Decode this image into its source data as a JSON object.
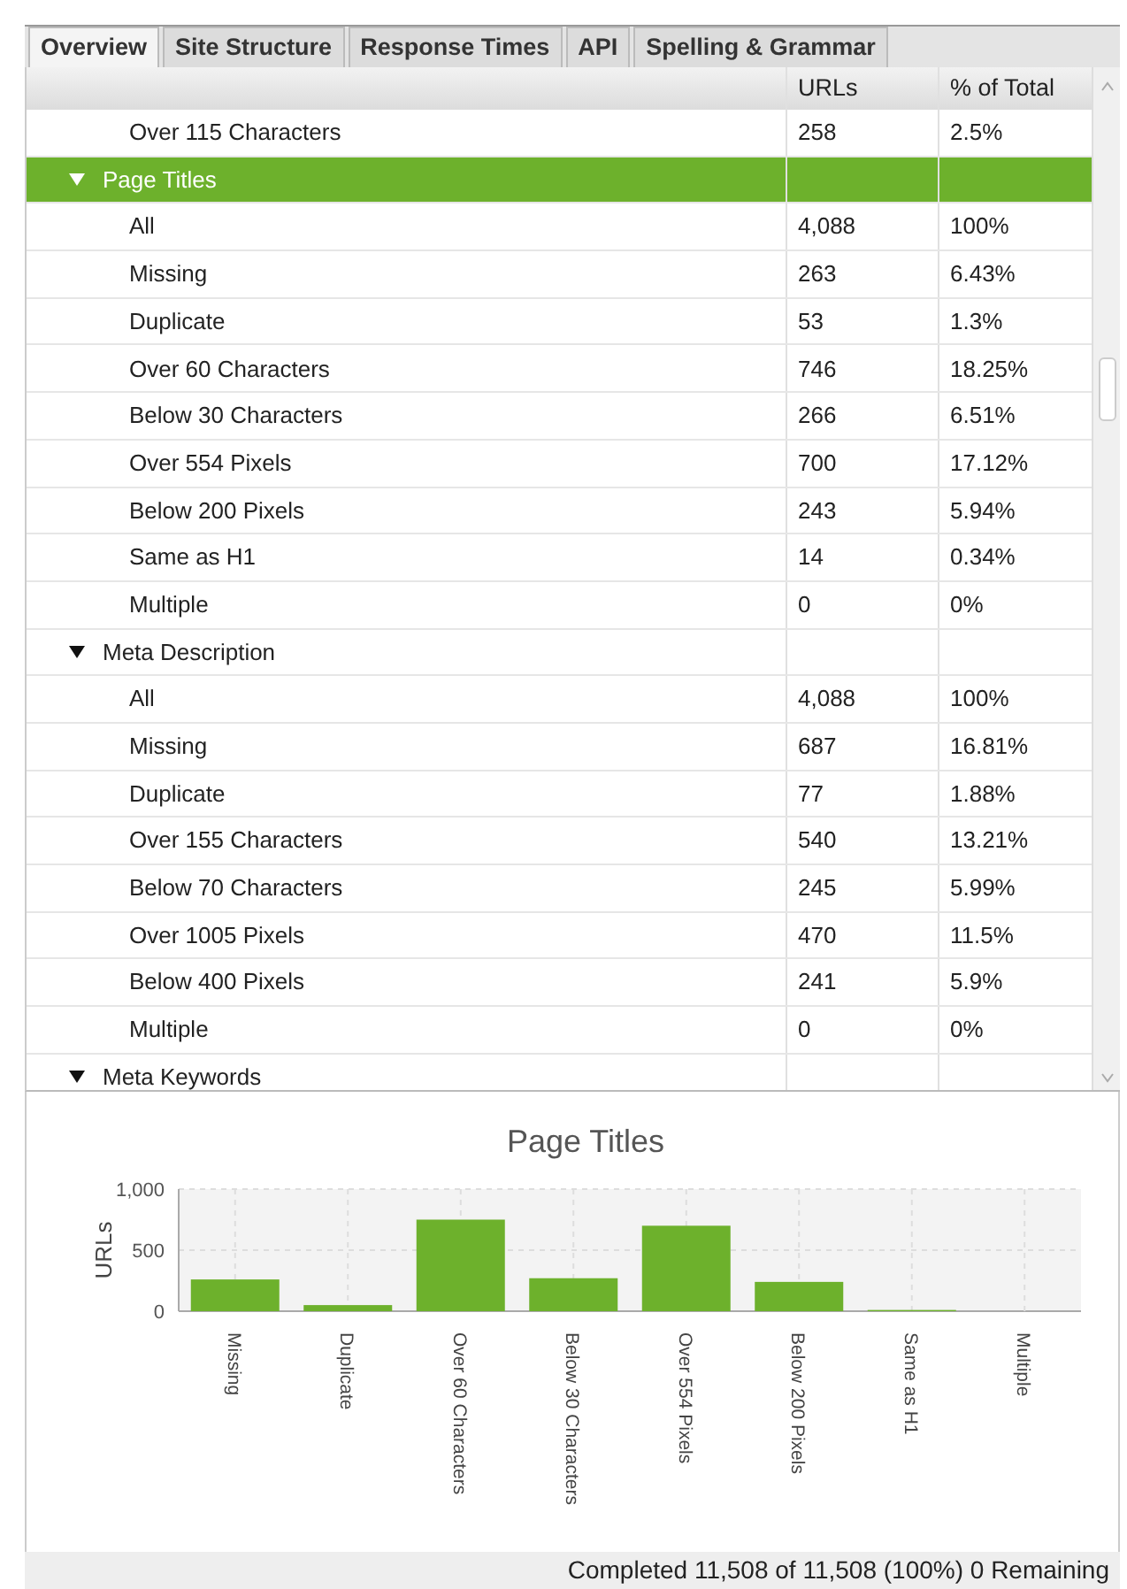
{
  "tabs": [
    {
      "label": "Overview",
      "selected": true
    },
    {
      "label": "Site Structure",
      "selected": false
    },
    {
      "label": "Response Times",
      "selected": false
    },
    {
      "label": "API",
      "selected": false
    },
    {
      "label": "Spelling & Grammar",
      "selected": false
    }
  ],
  "table": {
    "columns": [
      "URLs",
      "% of Total"
    ],
    "rows": [
      {
        "label": "Over 115 Characters",
        "urls": "258",
        "pct": "2.5%",
        "selected": false
      },
      {
        "label": "Page Titles",
        "expanded": true,
        "selected": true,
        "children": [
          {
            "label": "All",
            "urls": "4,088",
            "pct": "100%",
            "selected": false
          },
          {
            "label": "Missing",
            "urls": "263",
            "pct": "6.43%",
            "selected": false
          },
          {
            "label": "Duplicate",
            "urls": "53",
            "pct": "1.3%",
            "selected": false
          },
          {
            "label": "Over 60 Characters",
            "urls": "746",
            "pct": "18.25%",
            "selected": false
          },
          {
            "label": "Below 30 Characters",
            "urls": "266",
            "pct": "6.51%",
            "selected": false
          },
          {
            "label": "Over 554 Pixels",
            "urls": "700",
            "pct": "17.12%",
            "selected": false
          },
          {
            "label": "Below 200 Pixels",
            "urls": "243",
            "pct": "5.94%",
            "selected": false
          },
          {
            "label": "Same as H1",
            "urls": "14",
            "pct": "0.34%",
            "selected": false
          },
          {
            "label": "Multiple",
            "urls": "0",
            "pct": "0%",
            "selected": false
          }
        ]
      },
      {
        "label": "Meta Description",
        "expanded": true,
        "selected": false,
        "children": [
          {
            "label": "All",
            "urls": "4,088",
            "pct": "100%",
            "selected": false
          },
          {
            "label": "Missing",
            "urls": "687",
            "pct": "16.81%",
            "selected": false
          },
          {
            "label": "Duplicate",
            "urls": "77",
            "pct": "1.88%",
            "selected": false
          },
          {
            "label": "Over 155 Characters",
            "urls": "540",
            "pct": "13.21%",
            "selected": false
          },
          {
            "label": "Below 70 Characters",
            "urls": "245",
            "pct": "5.99%",
            "selected": false
          },
          {
            "label": "Over 1005 Pixels",
            "urls": "470",
            "pct": "11.5%",
            "selected": false
          },
          {
            "label": "Below 400 Pixels",
            "urls": "241",
            "pct": "5.9%",
            "selected": false
          },
          {
            "label": "Multiple",
            "urls": "0",
            "pct": "0%",
            "selected": false
          }
        ]
      },
      {
        "label": "Meta Keywords",
        "expanded": true,
        "selected": false
      }
    ]
  },
  "chart": {
    "chart_data": {
      "type": "bar",
      "title": "Page Titles",
      "ylabel": "URLs",
      "categories": [
        "Missing",
        "Duplicate",
        "Over 60 Characters",
        "Below 30 Characters",
        "Over 554 Pixels",
        "Below 200 Pixels",
        "Same as H1",
        "Multiple"
      ],
      "series": [
        {
          "color": "#6db12c",
          "values": [
            260,
            50,
            750,
            270,
            700,
            240,
            10,
            0
          ]
        }
      ],
      "ylim": [
        0,
        1000
      ],
      "grid": true,
      "yticks": [
        0,
        500,
        {
          "value": 1000,
          "label": "1,000"
        }
      ]
    }
  },
  "status_bar": "Completed 11,508 of 11,508 (100%) 0 Remaining"
}
